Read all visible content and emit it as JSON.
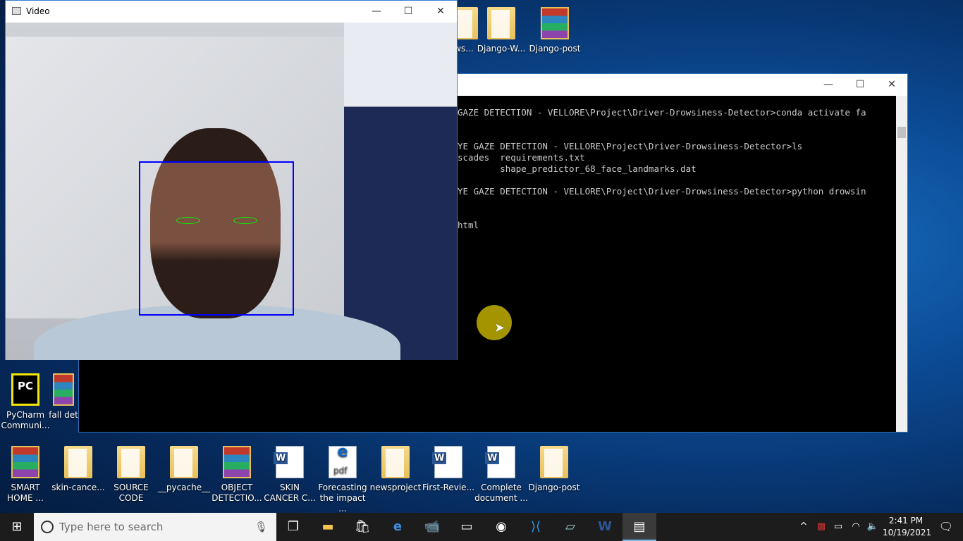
{
  "desktop_top_icons": [
    {
      "label": "ws...",
      "type": "folder"
    },
    {
      "label": "Django-W...",
      "type": "folder"
    },
    {
      "label": "Django-post",
      "type": "rar"
    }
  ],
  "desktop_left_icons": [
    {
      "label": "PyCharm Communi...",
      "type": "pycharm"
    },
    {
      "label": "fall det",
      "type": "rar"
    }
  ],
  "desktop_bottom_icons": [
    {
      "label": "SMART HOME ...",
      "type": "rar"
    },
    {
      "label": "skin-cance...",
      "type": "folder"
    },
    {
      "label": "SOURCE CODE",
      "type": "folder"
    },
    {
      "label": "__pycache__",
      "type": "folder"
    },
    {
      "label": "OBJECT DETECTIO...",
      "type": "rar"
    },
    {
      "label": "SKIN CANCER C...",
      "type": "word"
    },
    {
      "label": "Forecasting the impact ...",
      "type": "pdf"
    },
    {
      "label": "newsproject",
      "type": "folder"
    },
    {
      "label": "First-Revie...",
      "type": "word"
    },
    {
      "label": "Complete document ...",
      "type": "word"
    },
    {
      "label": "Django-post",
      "type": "folder"
    }
  ],
  "console": {
    "lines": [
      "GAZE DETECTION - VELLORE\\Project\\Driver-Drowsiness-Detector>conda activate fa",
      "YE GAZE DETECTION - VELLORE\\Project\\Driver-Drowsiness-Detector>ls",
      "scades  requirements.txt",
      "        shape_predictor_68_face_landmarks.dat",
      "YE GAZE DETECTION - VELLORE\\Project\\Driver-Drowsiness-Detector>python drowsin",
      "html"
    ]
  },
  "video": {
    "title": "Video",
    "face_box_color": "#0000ff",
    "eye_contour_color": "#00ff00"
  },
  "taskbar": {
    "search_placeholder": "Type here to search",
    "time": "2:41 PM",
    "date": "10/19/2021"
  },
  "colors": {
    "cursor_highlight": "#b5a400",
    "accent": "#0078d7"
  }
}
